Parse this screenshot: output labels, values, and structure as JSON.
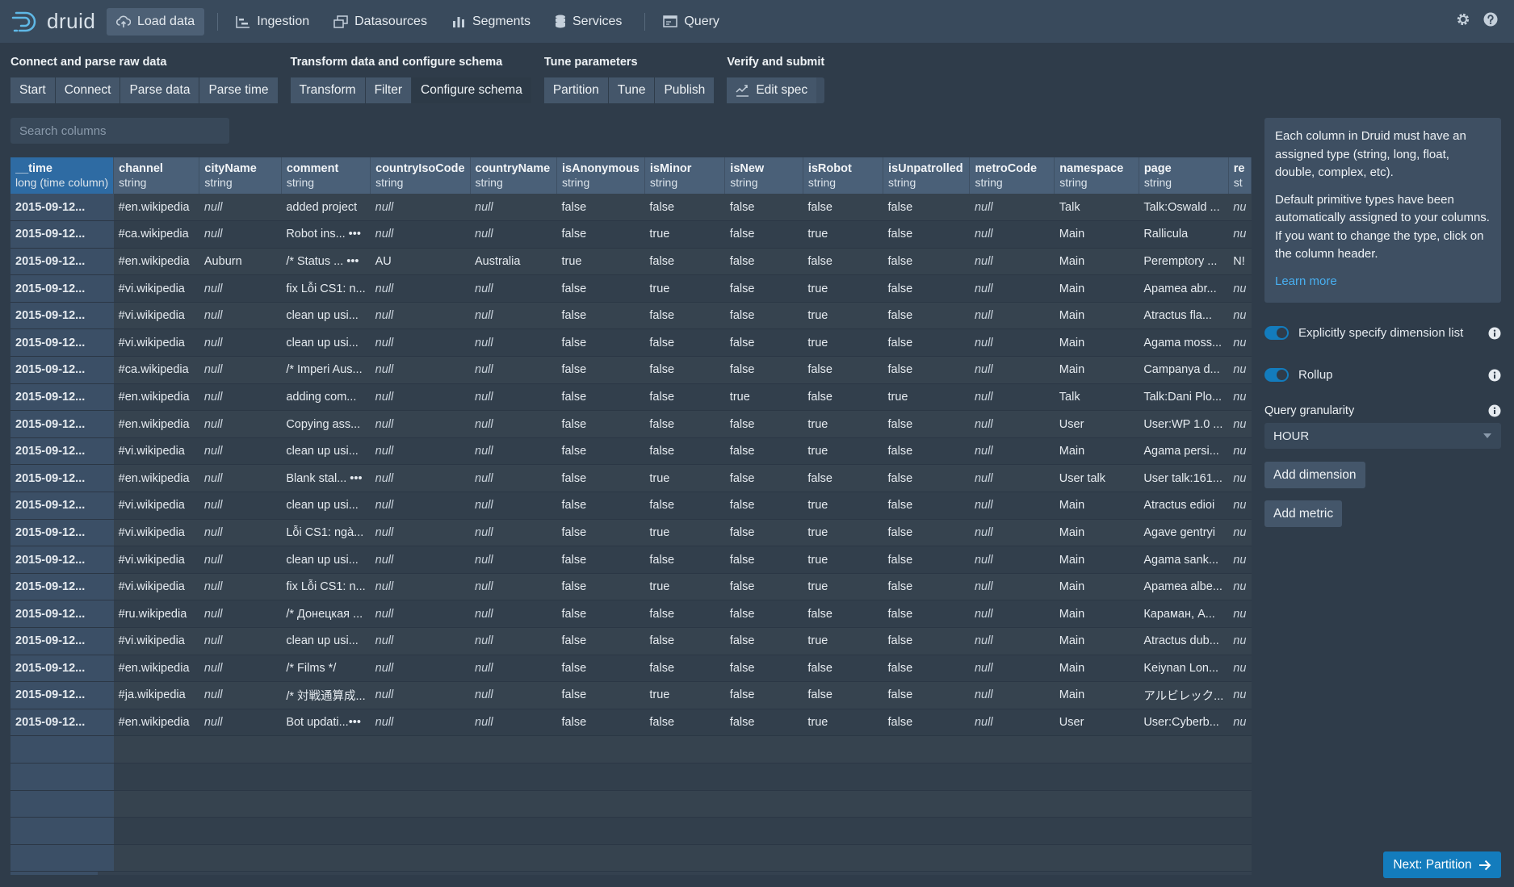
{
  "app": {
    "name": "druid"
  },
  "nav": {
    "items": [
      {
        "label": "Load data",
        "icon": "cloud-upload-icon",
        "active": true
      },
      {
        "label": "Ingestion",
        "icon": "chart-gantt-icon"
      },
      {
        "label": "Datasources",
        "icon": "multi-window-icon"
      },
      {
        "label": "Segments",
        "icon": "stacked-chart-icon"
      },
      {
        "label": "Services",
        "icon": "database-icon"
      },
      {
        "label": "Query",
        "icon": "application-icon"
      }
    ]
  },
  "steps": {
    "groups": [
      {
        "title": "Connect and parse raw data",
        "items": [
          "Start",
          "Connect",
          "Parse data",
          "Parse time"
        ]
      },
      {
        "title": "Transform data and configure schema",
        "items": [
          "Transform",
          "Filter",
          "Configure schema"
        ],
        "active": "Configure schema"
      },
      {
        "title": "Tune parameters",
        "items": [
          "Partition",
          "Tune",
          "Publish"
        ]
      },
      {
        "title": "Verify and submit",
        "items": [
          "Edit spec"
        ]
      }
    ]
  },
  "search": {
    "placeholder": "Search columns"
  },
  "table": {
    "columns": [
      {
        "name": "__time",
        "type": "long (time column)"
      },
      {
        "name": "channel",
        "type": "string"
      },
      {
        "name": "cityName",
        "type": "string"
      },
      {
        "name": "comment",
        "type": "string"
      },
      {
        "name": "countryIsoCode",
        "type": "string"
      },
      {
        "name": "countryName",
        "type": "string"
      },
      {
        "name": "isAnonymous",
        "type": "string"
      },
      {
        "name": "isMinor",
        "type": "string"
      },
      {
        "name": "isNew",
        "type": "string"
      },
      {
        "name": "isRobot",
        "type": "string"
      },
      {
        "name": "isUnpatrolled",
        "type": "string"
      },
      {
        "name": "metroCode",
        "type": "string"
      },
      {
        "name": "namespace",
        "type": "string"
      },
      {
        "name": "page",
        "type": "string"
      },
      {
        "name": "re",
        "type": "st"
      }
    ],
    "rows": [
      [
        "2015-09-12...",
        "#en.wikipedia",
        "null",
        "added project",
        "null",
        "null",
        "false",
        "false",
        "false",
        "false",
        "false",
        "null",
        "Talk",
        "Talk:Oswald ...",
        "nu"
      ],
      [
        "2015-09-12...",
        "#ca.wikipedia",
        "null",
        "Robot ins... •••",
        "null",
        "null",
        "false",
        "true",
        "false",
        "true",
        "false",
        "null",
        "Main",
        "Rallicula",
        "nu"
      ],
      [
        "2015-09-12...",
        "#en.wikipedia",
        "Auburn",
        "/* Status ... •••",
        "AU",
        "Australia",
        "true",
        "false",
        "false",
        "false",
        "false",
        "null",
        "Main",
        "Peremptory ...",
        "N!"
      ],
      [
        "2015-09-12...",
        "#vi.wikipedia",
        "null",
        "fix Lỗi CS1: n...",
        "null",
        "null",
        "false",
        "true",
        "false",
        "true",
        "false",
        "null",
        "Main",
        "Apamea abr...",
        "nu"
      ],
      [
        "2015-09-12...",
        "#vi.wikipedia",
        "null",
        "clean up usi...",
        "null",
        "null",
        "false",
        "false",
        "false",
        "true",
        "false",
        "null",
        "Main",
        "Atractus fla...",
        "nu"
      ],
      [
        "2015-09-12...",
        "#vi.wikipedia",
        "null",
        "clean up usi...",
        "null",
        "null",
        "false",
        "false",
        "false",
        "true",
        "false",
        "null",
        "Main",
        "Agama moss...",
        "nu"
      ],
      [
        "2015-09-12...",
        "#ca.wikipedia",
        "null",
        "/* Imperi Aus...",
        "null",
        "null",
        "false",
        "false",
        "false",
        "false",
        "false",
        "null",
        "Main",
        "Campanya d...",
        "nu"
      ],
      [
        "2015-09-12...",
        "#en.wikipedia",
        "null",
        "adding com...",
        "null",
        "null",
        "false",
        "false",
        "true",
        "false",
        "true",
        "null",
        "Talk",
        "Talk:Dani Plo...",
        "nu"
      ],
      [
        "2015-09-12...",
        "#en.wikipedia",
        "null",
        "Copying ass...",
        "null",
        "null",
        "false",
        "false",
        "false",
        "true",
        "false",
        "null",
        "User",
        "User:WP 1.0 ...",
        "nu"
      ],
      [
        "2015-09-12...",
        "#vi.wikipedia",
        "null",
        "clean up usi...",
        "null",
        "null",
        "false",
        "false",
        "false",
        "true",
        "false",
        "null",
        "Main",
        "Agama persi...",
        "nu"
      ],
      [
        "2015-09-12...",
        "#en.wikipedia",
        "null",
        "Blank stal... •••",
        "null",
        "null",
        "false",
        "true",
        "false",
        "false",
        "false",
        "null",
        "User talk",
        "User talk:161...",
        "nu"
      ],
      [
        "2015-09-12...",
        "#vi.wikipedia",
        "null",
        "clean up usi...",
        "null",
        "null",
        "false",
        "false",
        "false",
        "true",
        "false",
        "null",
        "Main",
        "Atractus edioi",
        "nu"
      ],
      [
        "2015-09-12...",
        "#vi.wikipedia",
        "null",
        "Lỗi CS1: ngà...",
        "null",
        "null",
        "false",
        "true",
        "false",
        "true",
        "false",
        "null",
        "Main",
        "Agave gentryi",
        "nu"
      ],
      [
        "2015-09-12...",
        "#vi.wikipedia",
        "null",
        "clean up usi...",
        "null",
        "null",
        "false",
        "false",
        "false",
        "true",
        "false",
        "null",
        "Main",
        "Agama sank...",
        "nu"
      ],
      [
        "2015-09-12...",
        "#vi.wikipedia",
        "null",
        "fix Lỗi CS1: n...",
        "null",
        "null",
        "false",
        "true",
        "false",
        "true",
        "false",
        "null",
        "Main",
        "Apamea albe...",
        "nu"
      ],
      [
        "2015-09-12...",
        "#ru.wikipedia",
        "null",
        "/* Донецкая ...",
        "null",
        "null",
        "false",
        "false",
        "false",
        "false",
        "false",
        "null",
        "Main",
        "Караман, А...",
        "nu"
      ],
      [
        "2015-09-12...",
        "#vi.wikipedia",
        "null",
        "clean up usi...",
        "null",
        "null",
        "false",
        "false",
        "false",
        "true",
        "false",
        "null",
        "Main",
        "Atractus dub...",
        "nu"
      ],
      [
        "2015-09-12...",
        "#en.wikipedia",
        "null",
        "/* Films */",
        "null",
        "null",
        "false",
        "false",
        "false",
        "false",
        "false",
        "null",
        "Main",
        "Keiynan Lon...",
        "nu"
      ],
      [
        "2015-09-12...",
        "#ja.wikipedia",
        "null",
        "/* 対戦通算成...",
        "null",
        "null",
        "false",
        "true",
        "false",
        "false",
        "false",
        "null",
        "Main",
        "アルビレック...",
        "nu"
      ],
      [
        "2015-09-12...",
        "#en.wikipedia",
        "null",
        "Bot updati...•••",
        "null",
        "null",
        "false",
        "false",
        "false",
        "true",
        "false",
        "null",
        "User",
        "User:Cyberb...",
        "nu"
      ]
    ]
  },
  "side": {
    "help": {
      "p1": "Each column in Druid must have an assigned type (string, long, float, double, complex, etc).",
      "p2": "Default primitive types have been automatically assigned to your columns. If you want to change the type, click on the column header.",
      "link": "Learn more"
    },
    "explicit_dims_label": "Explicitly specify dimension list",
    "rollup_label": "Rollup",
    "granularity_label": "Query granularity",
    "granularity_value": "HOUR",
    "add_dimension": "Add dimension",
    "add_metric": "Add metric"
  },
  "next_label": "Next: Partition",
  "colors": {
    "accent": "#137cbd",
    "background": "#2f3c4a",
    "header": "#4a6078"
  }
}
